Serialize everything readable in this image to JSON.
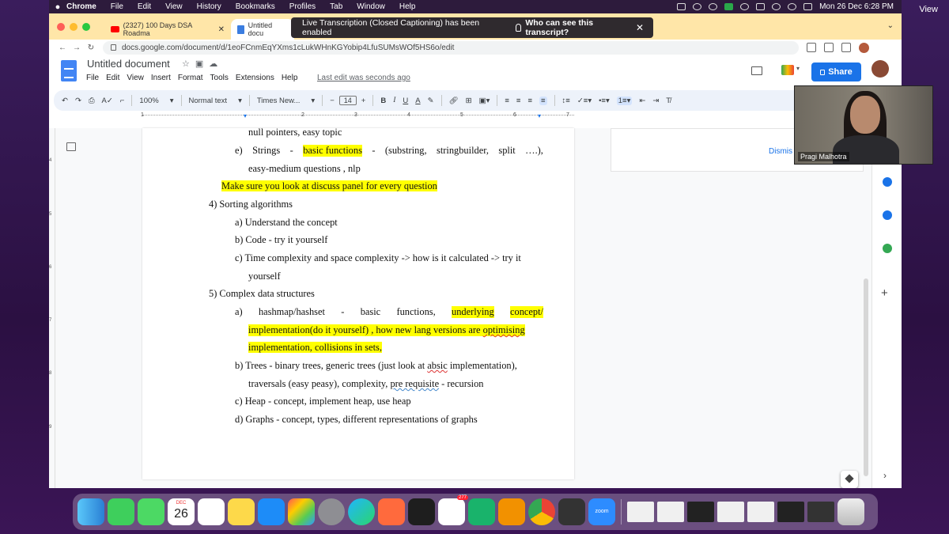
{
  "menubar": {
    "app": "Chrome",
    "items": [
      "File",
      "Edit",
      "View",
      "History",
      "Bookmarks",
      "Profiles",
      "Tab",
      "Window",
      "Help"
    ],
    "clock": "Mon 26 Dec  6:28 PM"
  },
  "view_button": "View",
  "browser": {
    "tabs": [
      {
        "label": "(2327) 100 Days DSA Roadma"
      },
      {
        "label": "Untitled docu"
      }
    ],
    "toast": {
      "message": "Live Transcription (Closed Captioning) has been enabled",
      "link": "Who can see this transcript?"
    },
    "url": "docs.google.com/document/d/1eoFCnmEqYXms1cLukWHnKGYobip4LfuSUMsWOf5HS6o/edit"
  },
  "docs": {
    "title": "Untitled document",
    "menus": [
      "File",
      "Edit",
      "View",
      "Insert",
      "Format",
      "Tools",
      "Extensions",
      "Help"
    ],
    "last_edit": "Last edit was seconds ago",
    "share": "Share",
    "zoom": "100%",
    "style": "Normal text",
    "font": "Times New...",
    "font_size": "14",
    "format_buttons": {
      "bold": "B",
      "italic": "I",
      "underline": "U",
      "text_color": "A"
    },
    "ruler_numbers": [
      "1",
      "2",
      "3",
      "4",
      "5",
      "6",
      "7"
    ],
    "vruler_numbers": [
      "4",
      "5",
      "6",
      "7",
      "8",
      "9"
    ],
    "dismiss": "Dismis",
    "content": {
      "l0": "null pointers, easy topic",
      "l1_label": "e)",
      "l1_a": "Strings",
      "l1_b": "-",
      "l1_c": "basic  functions",
      "l1_d": "-",
      "l1_e": "(substring,",
      "l1_f": "stringbuilder,",
      "l1_g": "split",
      "l1_h": "….),",
      "l2": "easy-medium questions , nlp",
      "l3": "Make sure you look at discuss panel for every question",
      "l4": "4)  Sorting algorithms",
      "l5": "a)  Understand the concept",
      "l6": "b)  Code - try it yourself",
      "l7": "c)  Time complexity and space complexity -> how is it calculated -> try it",
      "l8": "yourself",
      "l9": "5)  Complex data structures",
      "l10_label": "a)",
      "l10_a": "hashmap/hashset",
      "l10_b": "-",
      "l10_c": "basic",
      "l10_d": "functions,",
      "l10_e": "underlying",
      "l10_f": "concept/",
      "l11_a": "implementation(do it yourself) , how new lang versions are ",
      "l11_b": "optimising",
      "l12": "implementation, collisions in sets,",
      "l13_a": "b)  Trees - binary trees, generic trees (just look at ",
      "l13_b": "absic",
      "l13_c": " implementation),",
      "l14_a": "traversals (easy peasy), complexity, ",
      "l14_b": "pre requisite",
      "l14_c": " - recursion",
      "l15": "c)  Heap - concept, implement heap, use heap",
      "l16": "d)  Graphs - concept, types, different representations of graphs"
    }
  },
  "video": {
    "name": "Pragi Malhotra"
  },
  "dock": {
    "calendar_day": "26",
    "slack_badge": "277",
    "zoom_label": "zoom"
  },
  "colors": {
    "highlight": "#ffff00",
    "share": "#1a73e8",
    "tabstrip": "#ffe6a8"
  }
}
